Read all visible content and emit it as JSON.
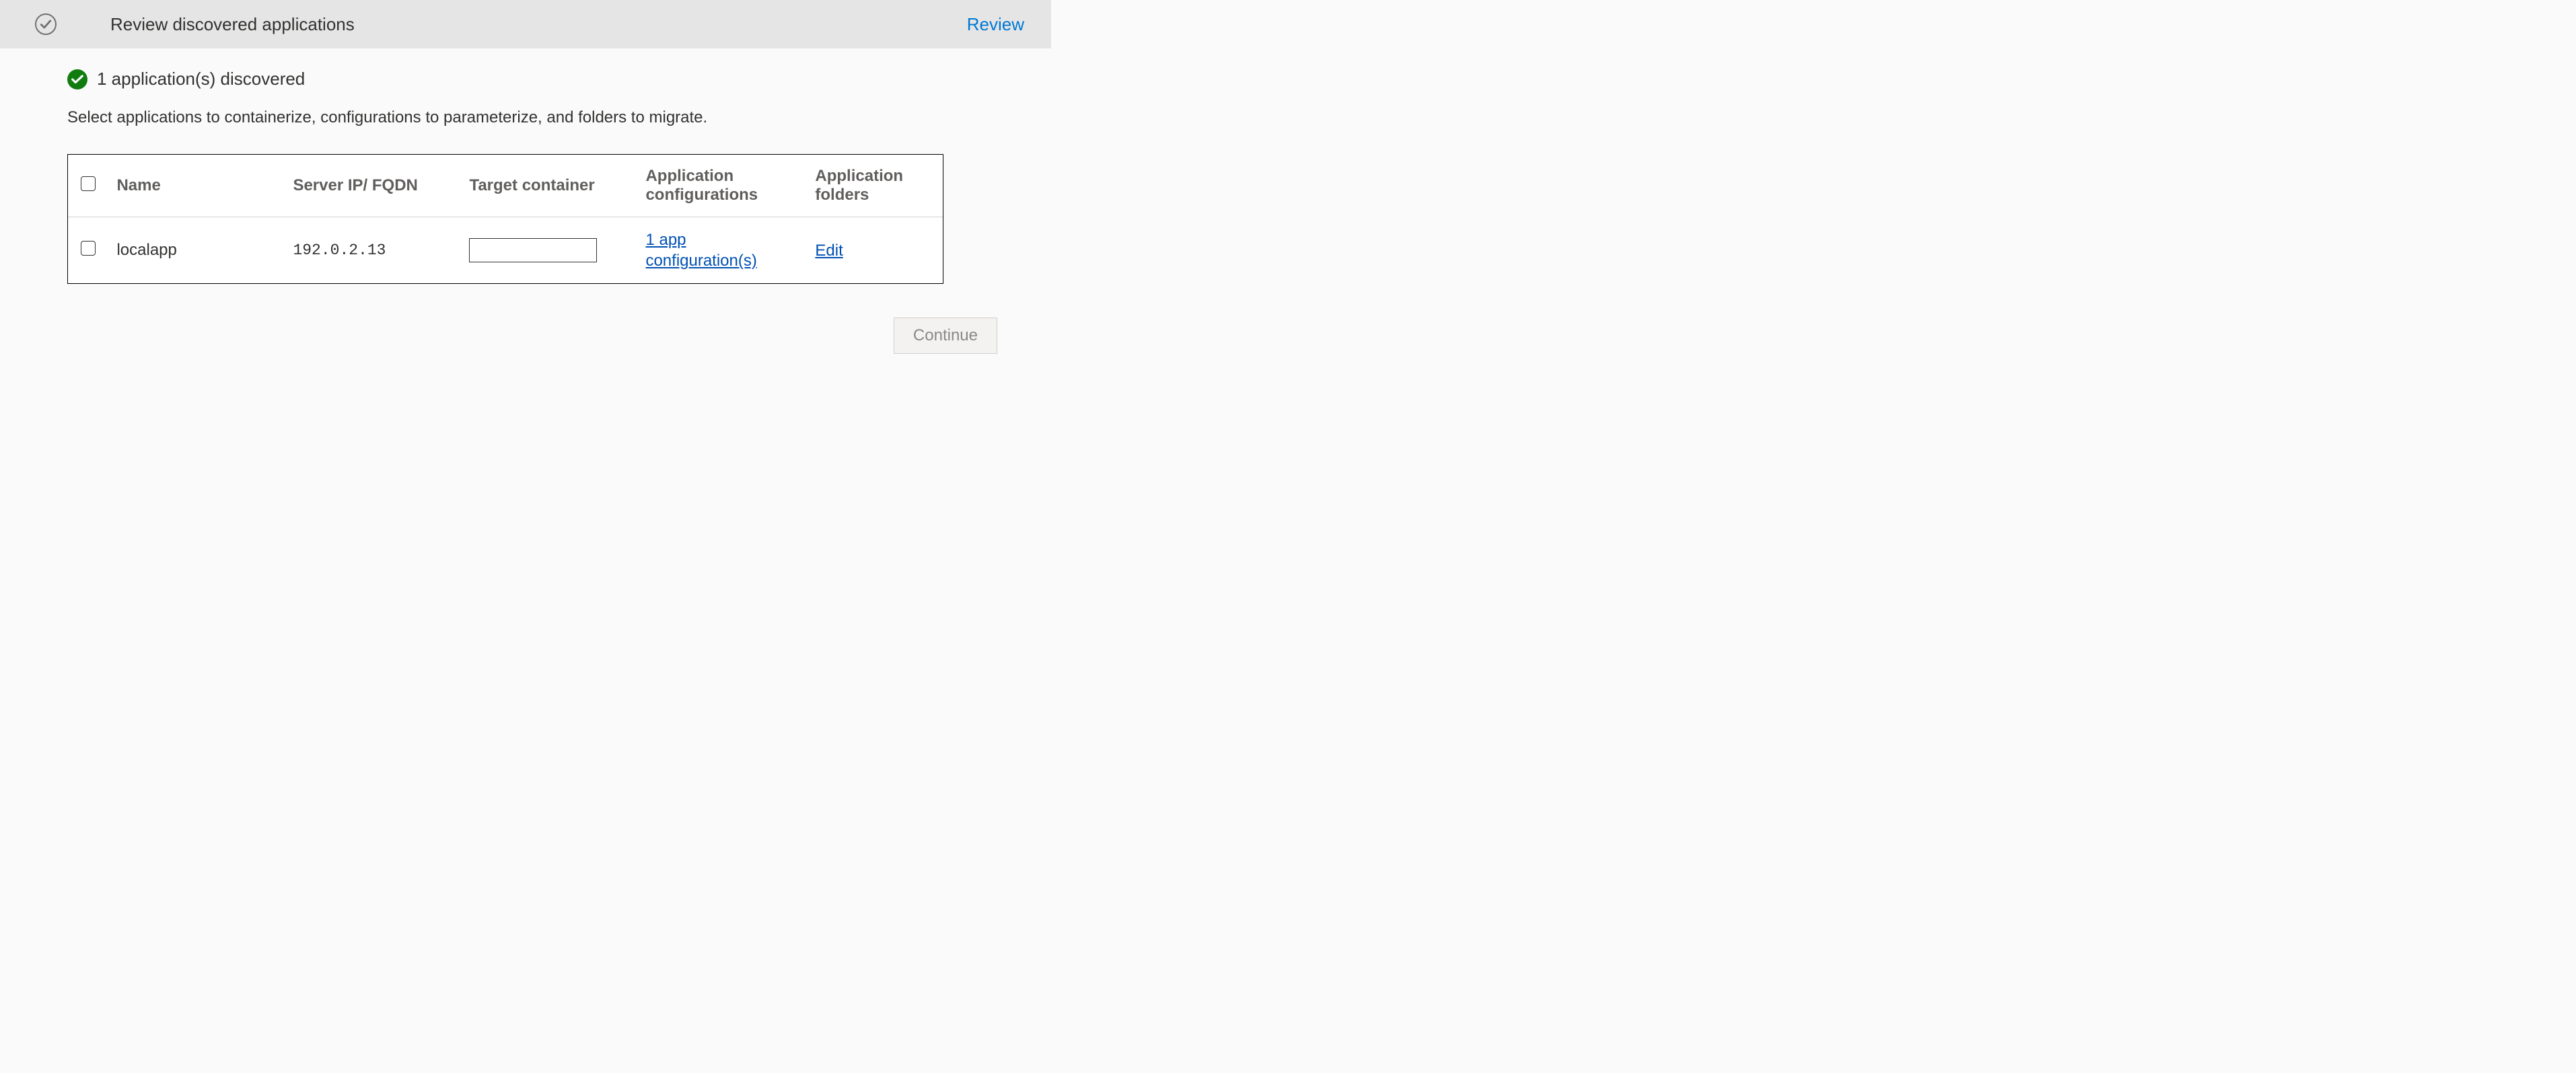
{
  "header": {
    "title": "Review discovered applications",
    "review_link": "Review"
  },
  "status": {
    "message": "1 application(s) discovered"
  },
  "instruction": "Select applications to containerize, configurations to parameterize, and folders to migrate.",
  "table": {
    "headers": {
      "name": "Name",
      "server": "Server IP/ FQDN",
      "target": "Target container",
      "config": "Application configurations",
      "folders": "Application folders"
    },
    "rows": [
      {
        "name": "localapp",
        "server": "192.0.2.13",
        "target": "",
        "config_link": "1 app configuration(s)",
        "folders_link": "Edit"
      }
    ]
  },
  "buttons": {
    "continue": "Continue"
  }
}
